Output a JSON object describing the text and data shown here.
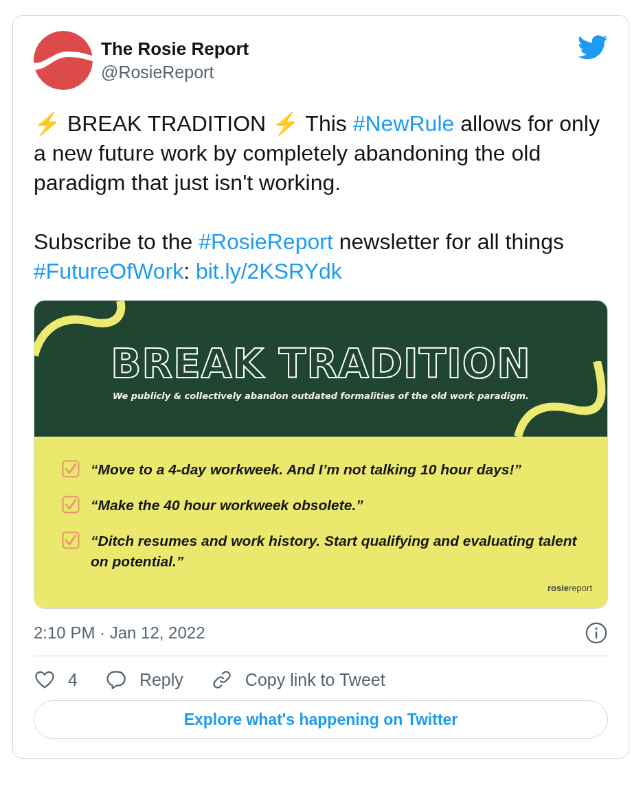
{
  "author": {
    "name": "The Rosie Report",
    "handle": "@RosieReport"
  },
  "text": [
    [
      {
        "kind": "plain",
        "text": "⚡ BREAK TRADITION ⚡ This "
      },
      {
        "kind": "link",
        "text": "#NewRule"
      },
      {
        "kind": "plain",
        "text": " allows for only a new future work by completely abandoning the old paradigm that just isn't working."
      }
    ],
    [
      {
        "kind": "plain",
        "text": "Subscribe to the "
      },
      {
        "kind": "link",
        "text": "#RosieReport"
      },
      {
        "kind": "plain",
        "text": " newsletter for all things "
      },
      {
        "kind": "link",
        "text": "#FutureOfWork"
      },
      {
        "kind": "plain",
        "text": ": "
      },
      {
        "kind": "link",
        "text": "bit.ly/2KSRYdk"
      }
    ]
  ],
  "graphic": {
    "title": "BREAK TRADITION",
    "subtitle": "We publicly & collectively abandon outdated formalities of the old work paradigm.",
    "items": [
      {
        "text": "“Move to a 4-day workweek. And I’m not talking 10 hour days!”",
        "checked": true
      },
      {
        "text": "“Make the 40 hour workweek obsolete.”",
        "checked": true
      },
      {
        "text": "“Ditch resumes and work history. Start qualifying and evaluating talent on potential.”",
        "checked": true
      }
    ],
    "logo": "**rosie**report"
  },
  "timestamp": "2:10 PM · Jan 12, 2022",
  "actions": [
    {
      "kind": "like",
      "label": "4"
    },
    {
      "kind": "reply",
      "label": "Reply"
    },
    {
      "kind": "copy",
      "label": "Copy link to Tweet"
    }
  ],
  "explore_button": "Explore what's happening on Twitter"
}
